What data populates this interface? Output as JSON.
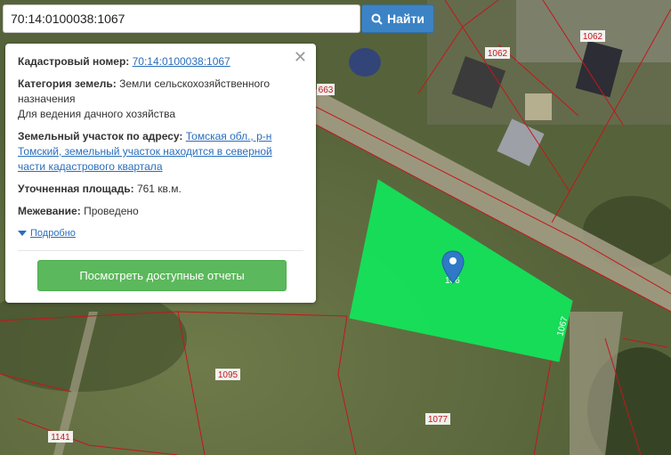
{
  "search": {
    "value": "70:14:0100038:1067",
    "button_label": "Найти"
  },
  "popup": {
    "cadastral": {
      "label": "Кадастровый номер:",
      "value": "70:14:0100038:1067"
    },
    "category": {
      "label": "Категория земель:",
      "value_line1": "Земли сельскохозяйственного",
      "value_line2": "назначения",
      "use": "Для ведения дачного хозяйства"
    },
    "address": {
      "label": "Земельный участок по адресу:",
      "line1": "Томская обл., р-н",
      "line2": "Томский, земельный участок находится в северной",
      "line3": "части кадастрового квартала"
    },
    "area": {
      "label": "Уточненная площадь:",
      "value": "761 кв.м."
    },
    "survey": {
      "label": "Межевание:",
      "value": "Проведено"
    },
    "details_link": "Подробно",
    "report_button": "Посмотреть доступные отчеты"
  },
  "map": {
    "parcel_fill_color": "#14e35a",
    "boundary_color": "#c4161c",
    "marker_color": "#2f79c7",
    "labels": {
      "p1062a": "1062",
      "p1062b": "1062",
      "p663": "663",
      "p1067_inside": "106",
      "p1067_edge": "1067",
      "p1095": "1095",
      "p1077": "1077",
      "p1141": "1141",
      "p_top": "1062"
    }
  }
}
